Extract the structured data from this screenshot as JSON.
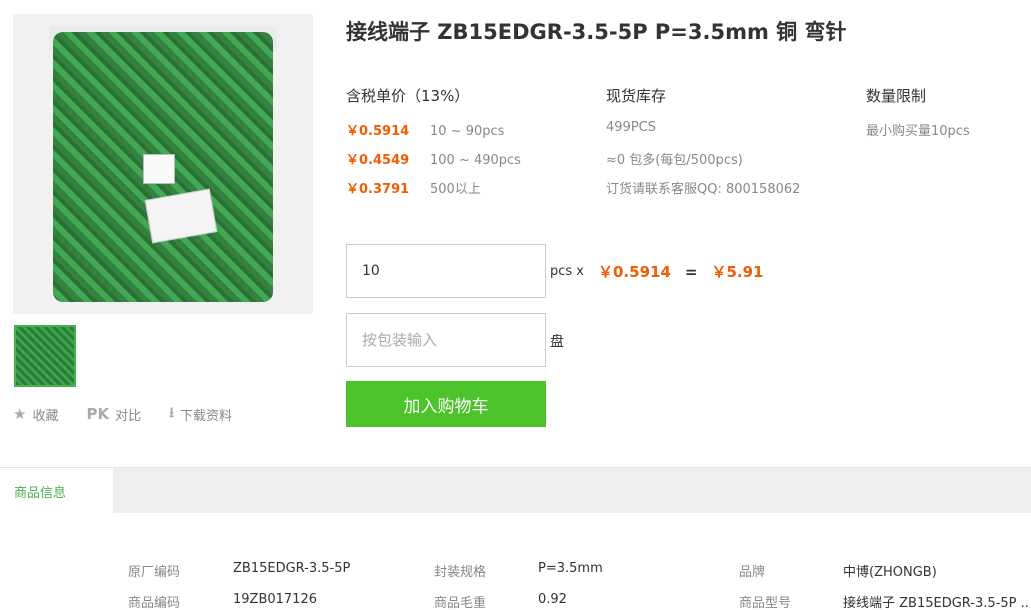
{
  "product": {
    "title": "接线端子 ZB15EDGR-3.5-5P P=3.5mm 铜 弯针"
  },
  "actions": {
    "favorite": "收藏",
    "pk_icon": "PK",
    "compare": "对比",
    "download": "下载资料"
  },
  "pricing": {
    "header": "含税单价（13%）",
    "tiers": [
      {
        "price": "￥0.5914",
        "range": "10 ~ 90pcs"
      },
      {
        "price": "￥0.4549",
        "range": "100 ~ 490pcs"
      },
      {
        "price": "￥0.3791",
        "range": "500以上"
      }
    ]
  },
  "stock": {
    "header": "现货库存",
    "lines": [
      "499PCS",
      "≈0 包多(每包/500pcs)",
      "订货请联系客服QQ: 800158062"
    ]
  },
  "limit": {
    "header": "数量限制",
    "text": "最小购买量10pcs"
  },
  "order": {
    "qty_value": "10",
    "unit_text": "pcs x",
    "unit_price": "￥0.5914",
    "equals": "=",
    "total": "￥5.91",
    "pkg_placeholder": "按包装输入",
    "pkg_unit": "盘",
    "cart_button": "加入购物车"
  },
  "tabs": {
    "active": "商品信息"
  },
  "specs": [
    {
      "k1": "原厂编码",
      "v1": "ZB15EDGR-3.5-5P",
      "k2": "封装规格",
      "v2": "P=3.5mm",
      "k3": "品牌",
      "v3": "中博(ZHONGB)"
    },
    {
      "k1": "商品编码",
      "v1": "19ZB017126",
      "k2": "商品毛重",
      "v2": "0.92",
      "k3": "商品型号",
      "v3": "接线端子 ZB15EDGR-3.5-5P ..."
    }
  ],
  "colors": {
    "accent_green": "#4cc32a",
    "price_orange": "#f25c05"
  }
}
